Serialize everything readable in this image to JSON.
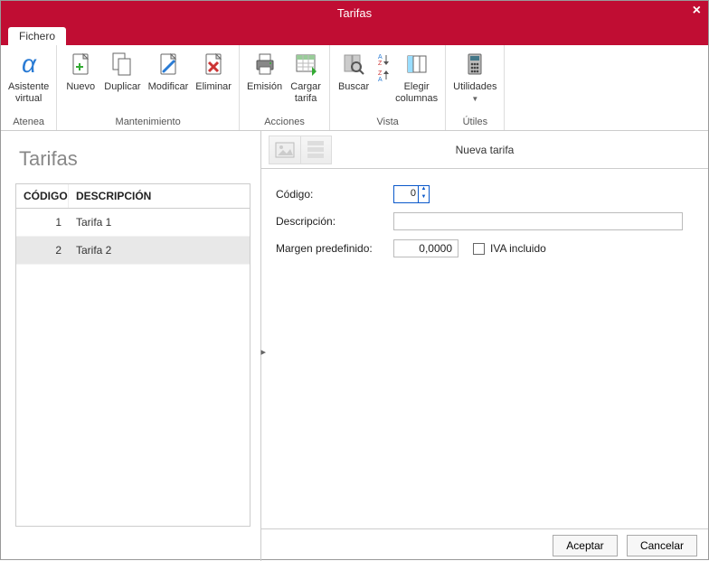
{
  "window": {
    "title": "Tarifas"
  },
  "tabs": {
    "file": "Fichero"
  },
  "ribbon": {
    "atenea": {
      "label": "Atenea",
      "asistente": "Asistente\nvirtual"
    },
    "mantenimiento": {
      "label": "Mantenimiento",
      "nuevo": "Nuevo",
      "duplicar": "Duplicar",
      "modificar": "Modificar",
      "eliminar": "Eliminar"
    },
    "acciones": {
      "label": "Acciones",
      "emision": "Emisión",
      "cargar": "Cargar\ntarifa"
    },
    "vista": {
      "label": "Vista",
      "buscar": "Buscar",
      "elegir": "Elegir\ncolumnas"
    },
    "utiles": {
      "label": "Útiles",
      "utilidades": "Utilidades"
    }
  },
  "page": {
    "title": "Tarifas"
  },
  "grid": {
    "cols": {
      "codigo": "CÓDIGO",
      "descripcion": "DESCRIPCIÓN"
    },
    "rows": [
      {
        "codigo": "1",
        "descripcion": "Tarifa 1",
        "selected": false
      },
      {
        "codigo": "2",
        "descripcion": "Tarifa 2",
        "selected": true
      }
    ]
  },
  "form": {
    "title": "Nueva tarifa",
    "fields": {
      "codigo_label": "Código:",
      "codigo_value": "0",
      "descripcion_label": "Descripción:",
      "descripcion_value": "",
      "margen_label": "Margen predefinido:",
      "margen_value": "0,0000",
      "iva_label": "IVA incluido",
      "iva_checked": false
    }
  },
  "footer": {
    "aceptar": "Aceptar",
    "cancelar": "Cancelar"
  }
}
